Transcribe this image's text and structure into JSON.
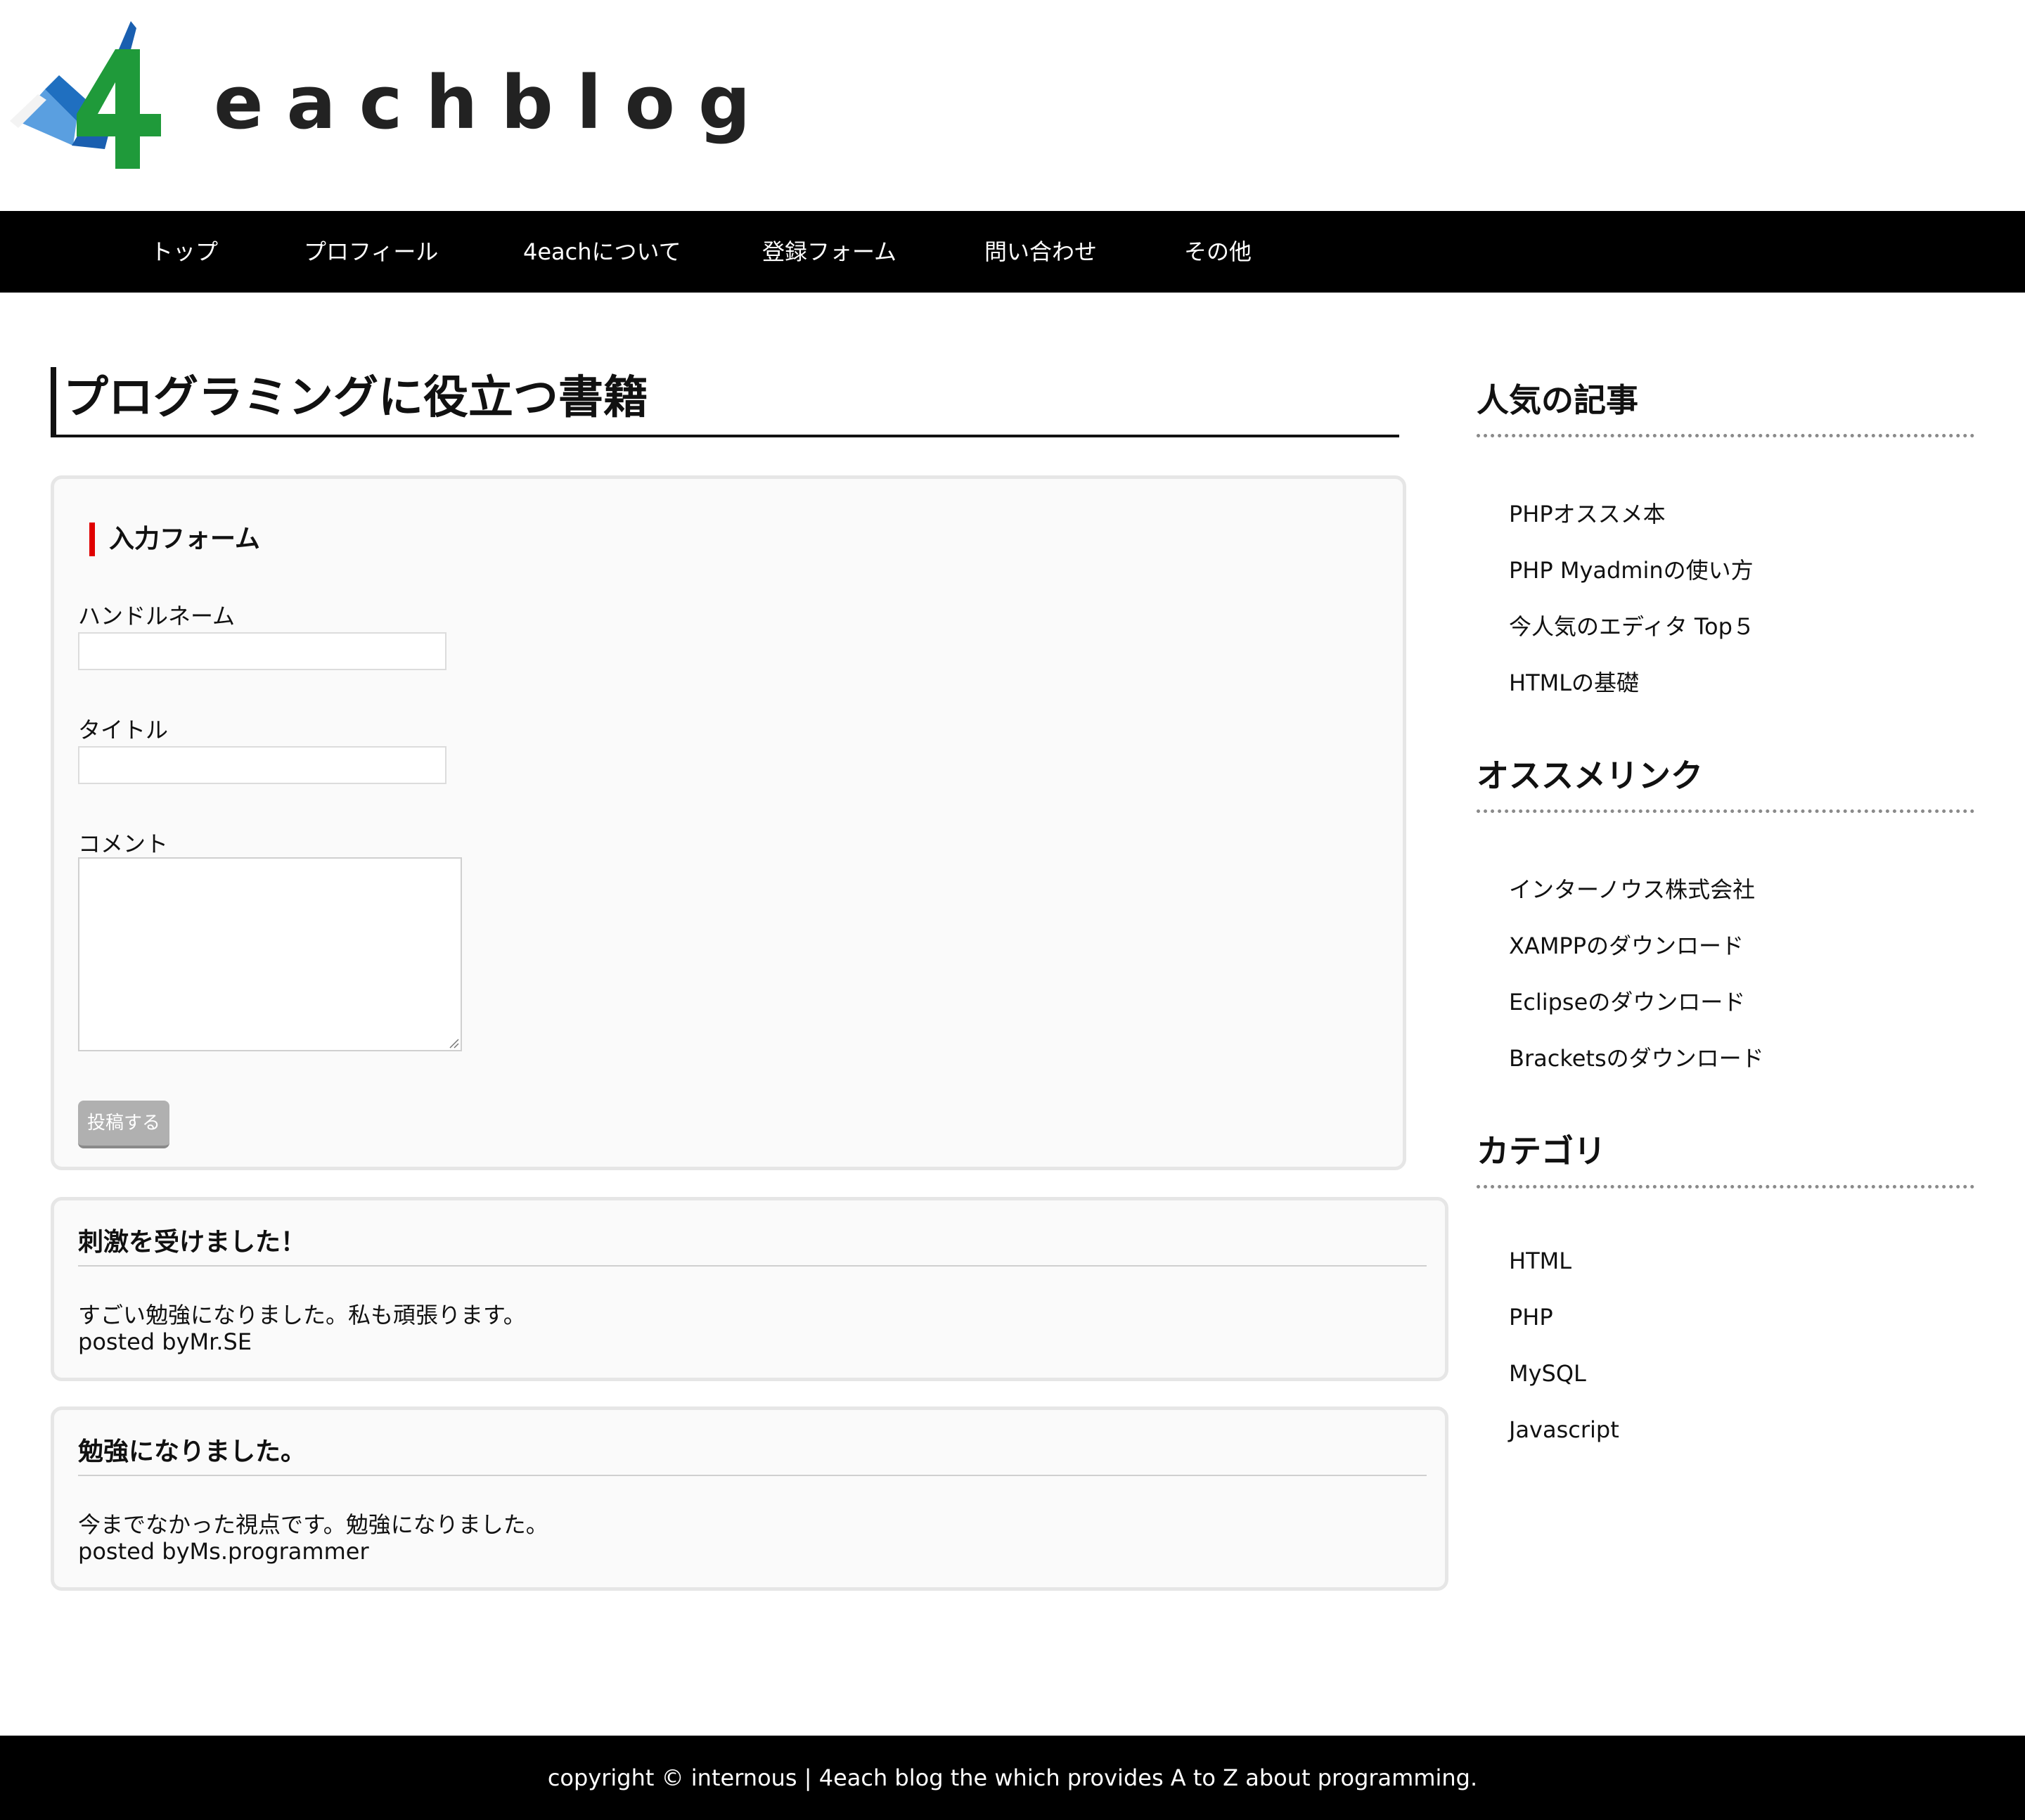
{
  "logo": {
    "text": "eachblog",
    "alt": "4eachblog logo"
  },
  "nav": {
    "items": [
      {
        "label": "トップ"
      },
      {
        "label": "プロフィール"
      },
      {
        "label": "4eachについて"
      },
      {
        "label": "登録フォーム"
      },
      {
        "label": "問い合わせ"
      },
      {
        "label": "その他"
      }
    ]
  },
  "article": {
    "title": "プログラミングに役立つ書籍"
  },
  "form": {
    "heading": "入力フォーム",
    "handle_label": "ハンドルネーム",
    "handle_value": "",
    "title_label": "タイトル",
    "title_value": "",
    "comment_label": "コメント",
    "comment_value": "",
    "submit_label": "投稿する"
  },
  "comments": [
    {
      "title": "刺激を受けました！",
      "body": "すごい勉強になりました。私も頑張ります。",
      "author": "posted byMr.SE"
    },
    {
      "title": "勉強になりました。",
      "body": "今までなかった視点です。勉強になりました。",
      "author": "posted byMs.programmer"
    }
  ],
  "sidebar": {
    "popular": {
      "heading": "人気の記事",
      "links": [
        "PHPオススメ本",
        "PHP Myadminの使い方",
        "今人気のエディタ Top５",
        "HTMLの基礎"
      ]
    },
    "recommended": {
      "heading": "オススメリンク",
      "links": [
        "インターノウス株式会社",
        "XAMPPのダウンロード",
        "Eclipseのダウンロード",
        "Bracketsのダウンロード"
      ]
    },
    "category": {
      "heading": "カテゴリ",
      "links": [
        "HTML",
        "PHP",
        "MySQL",
        "Javascript"
      ]
    }
  },
  "footer": {
    "text": "copyright © internous | 4each blog the which provides A to Z about programming."
  },
  "colors": {
    "nav_bg": "#000000",
    "accent_red": "#e00000",
    "logo_blue": "#1f6fc0",
    "logo_green": "#1f9a3a"
  }
}
